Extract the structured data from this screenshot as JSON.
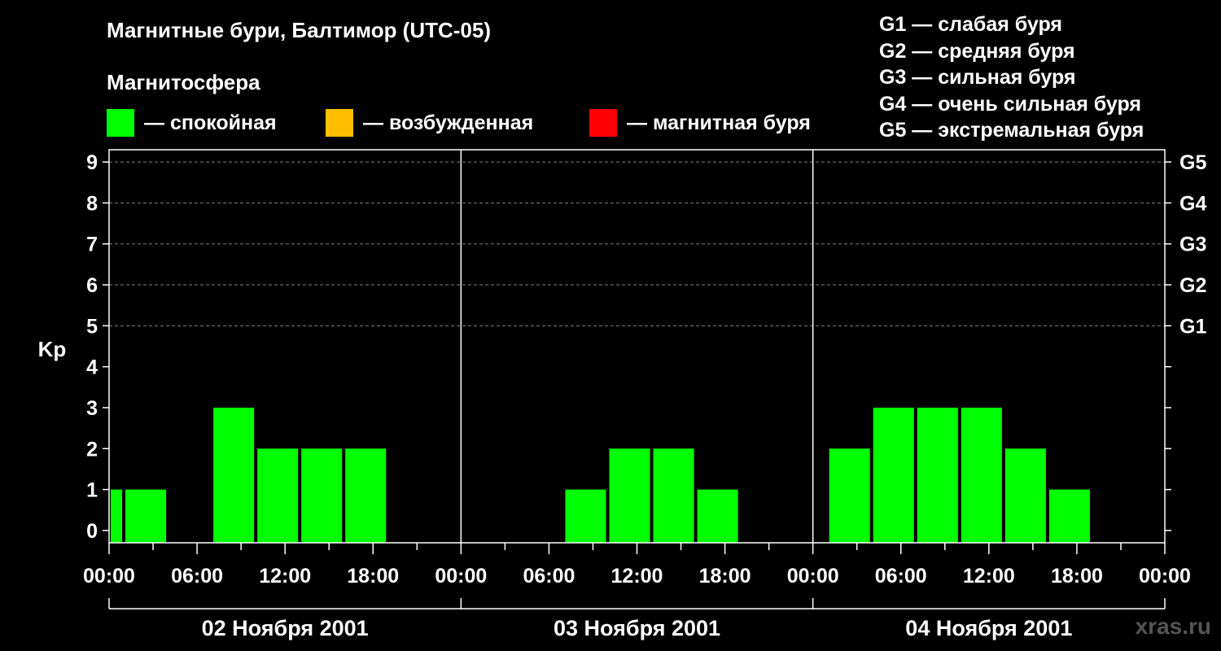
{
  "title": "Магнитные бури, Балтимор (UTC-05)",
  "subtitle": "Магнитосфера",
  "legend": [
    {
      "label": "— спокойная",
      "color": "#00ff00"
    },
    {
      "label": "— возбужденная",
      "color": "#ffbf00"
    },
    {
      "label": "— магнитная буря",
      "color": "#ff0000"
    }
  ],
  "storm_scale_legend": [
    "G1 — слабая буря",
    "G2 — средняя буря",
    "G3 — сильная буря",
    "G4 — очень сильная буря",
    "G5 — экстремальная буря"
  ],
  "watermark": "xras.ru",
  "chart_data": {
    "type": "bar",
    "ylabel": "Kp",
    "ylim": [
      -0.3,
      9.3
    ],
    "yticks": [
      0,
      1,
      2,
      3,
      4,
      5,
      6,
      7,
      8,
      9
    ],
    "right_axis_labels": [
      {
        "kp": 5,
        "label": "G1"
      },
      {
        "kp": 6,
        "label": "G2"
      },
      {
        "kp": 7,
        "label": "G3"
      },
      {
        "kp": 8,
        "label": "G4"
      },
      {
        "kp": 9,
        "label": "G5"
      }
    ],
    "grid": "dashed horizontal at Kp 5–9",
    "xlim_hours": [
      0,
      72
    ],
    "xtick_labels": [
      "00:00",
      "06:00",
      "12:00",
      "18:00",
      "00:00",
      "06:00",
      "12:00",
      "18:00",
      "00:00",
      "06:00",
      "12:00",
      "18:00",
      "00:00"
    ],
    "days": [
      "02 Ноября 2001",
      "03 Ноября 2001",
      "04 Ноября 2001"
    ],
    "series": [
      {
        "points": [
          {
            "start_hour": 0,
            "end_hour": 1,
            "kp": 1
          },
          {
            "start_hour": 1,
            "end_hour": 4,
            "kp": 1
          },
          {
            "start_hour": 7,
            "end_hour": 10,
            "kp": 3
          },
          {
            "start_hour": 10,
            "end_hour": 13,
            "kp": 2
          },
          {
            "start_hour": 13,
            "end_hour": 16,
            "kp": 2
          },
          {
            "start_hour": 16,
            "end_hour": 19,
            "kp": 2
          },
          {
            "start_hour": 31,
            "end_hour": 34,
            "kp": 1
          },
          {
            "start_hour": 34,
            "end_hour": 37,
            "kp": 2
          },
          {
            "start_hour": 37,
            "end_hour": 40,
            "kp": 2
          },
          {
            "start_hour": 40,
            "end_hour": 43,
            "kp": 1
          },
          {
            "start_hour": 49,
            "end_hour": 52,
            "kp": 2
          },
          {
            "start_hour": 52,
            "end_hour": 55,
            "kp": 3
          },
          {
            "start_hour": 55,
            "end_hour": 58,
            "kp": 3
          },
          {
            "start_hour": 58,
            "end_hour": 61,
            "kp": 3
          },
          {
            "start_hour": 61,
            "end_hour": 64,
            "kp": 2
          },
          {
            "start_hour": 64,
            "end_hour": 67,
            "kp": 1
          }
        ]
      }
    ]
  }
}
